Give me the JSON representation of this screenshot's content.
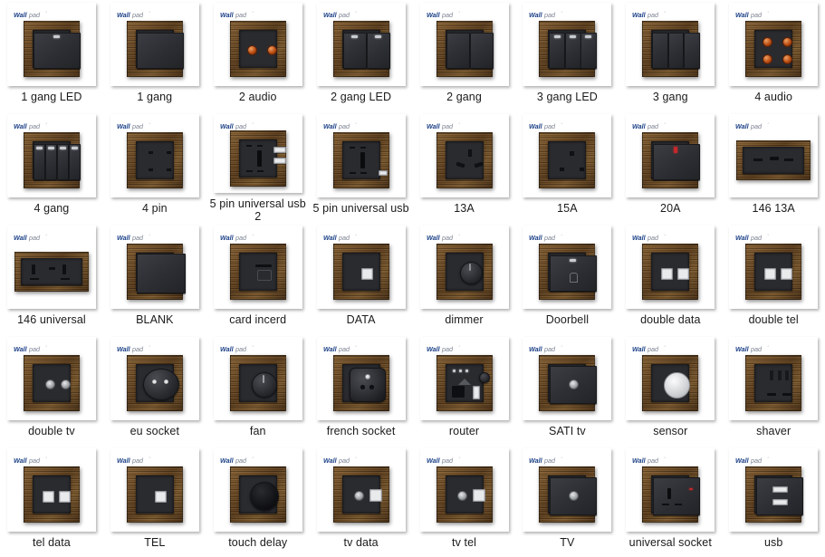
{
  "brand": {
    "logo_text": "Wallpad",
    "logo_mark": "wallpad-logo"
  },
  "gallery": {
    "columns": 8,
    "rows": 5,
    "background_color": "#ffffff",
    "frame_color": "#6b4a24",
    "module_color": "#2a2b2f",
    "caption_color": "#1b1b1b",
    "items": [
      {
        "label": "1 gang LED",
        "kind": "gang",
        "gangs": 1,
        "led": true,
        "shape": "square"
      },
      {
        "label": "1 gang",
        "kind": "gang",
        "gangs": 1,
        "led": false,
        "shape": "square"
      },
      {
        "label": "2 audio",
        "kind": "audio",
        "posts": 2,
        "shape": "square"
      },
      {
        "label": "2 gang LED",
        "kind": "gang",
        "gangs": 2,
        "led": true,
        "shape": "square"
      },
      {
        "label": "2 gang",
        "kind": "gang",
        "gangs": 2,
        "led": false,
        "shape": "square"
      },
      {
        "label": "3 gang LED",
        "kind": "gang",
        "gangs": 3,
        "led": true,
        "shape": "square"
      },
      {
        "label": "3 gang",
        "kind": "gang",
        "gangs": 3,
        "led": false,
        "shape": "square"
      },
      {
        "label": "4 audio",
        "kind": "audio",
        "posts": 4,
        "shape": "square"
      },
      {
        "label": "4 gang",
        "kind": "gang",
        "gangs": 4,
        "led": true,
        "shape": "square"
      },
      {
        "label": "4 pin",
        "kind": "pin4",
        "shape": "square"
      },
      {
        "label": "5 pin universal usb 2",
        "kind": "universal-usb2",
        "shape": "square"
      },
      {
        "label": "5 pin universal usb",
        "kind": "universal-usb",
        "shape": "square"
      },
      {
        "label": "13A",
        "kind": "uk13a",
        "shape": "square"
      },
      {
        "label": "15A",
        "kind": "uk15a",
        "shape": "square"
      },
      {
        "label": "20A",
        "kind": "switch20a",
        "shape": "square"
      },
      {
        "label": "146 13A",
        "kind": "double13a",
        "shape": "wide"
      },
      {
        "label": "146 universal",
        "kind": "doubleuniversal",
        "shape": "wide"
      },
      {
        "label": "BLANK",
        "kind": "blank",
        "shape": "square"
      },
      {
        "label": "card incerd",
        "kind": "cardinsert",
        "shape": "square"
      },
      {
        "label": "DATA",
        "kind": "data",
        "ports": 1,
        "shape": "square"
      },
      {
        "label": "dimmer",
        "kind": "dimmer",
        "shape": "square"
      },
      {
        "label": "Doorbell",
        "kind": "doorbell",
        "shape": "square"
      },
      {
        "label": "double data",
        "kind": "data",
        "ports": 2,
        "shape": "square"
      },
      {
        "label": "double tel",
        "kind": "data",
        "ports": 2,
        "shape": "square"
      },
      {
        "label": "double tv",
        "kind": "doubletv",
        "shape": "square"
      },
      {
        "label": "eu socket",
        "kind": "eusocket",
        "shape": "square"
      },
      {
        "label": "fan",
        "kind": "fan",
        "shape": "square"
      },
      {
        "label": "french socket",
        "kind": "frenchsocket",
        "shape": "square"
      },
      {
        "label": "router",
        "kind": "router",
        "shape": "square"
      },
      {
        "label": "SATI tv",
        "kind": "satitv",
        "shape": "square"
      },
      {
        "label": "sensor",
        "kind": "sensor",
        "shape": "square"
      },
      {
        "label": "shaver",
        "kind": "shaver",
        "shape": "square"
      },
      {
        "label": "tel data",
        "kind": "data",
        "ports": 2,
        "shape": "square"
      },
      {
        "label": "TEL",
        "kind": "data",
        "ports": 1,
        "shape": "square"
      },
      {
        "label": "touch delay",
        "kind": "touchdelay",
        "shape": "square"
      },
      {
        "label": "tv data",
        "kind": "tvdata",
        "shape": "square"
      },
      {
        "label": "tv tel",
        "kind": "tvdata",
        "shape": "square"
      },
      {
        "label": "TV",
        "kind": "satitv",
        "shape": "square"
      },
      {
        "label": "universal socket",
        "kind": "universalsocket",
        "shape": "square"
      },
      {
        "label": "usb",
        "kind": "usb",
        "shape": "square"
      }
    ]
  }
}
